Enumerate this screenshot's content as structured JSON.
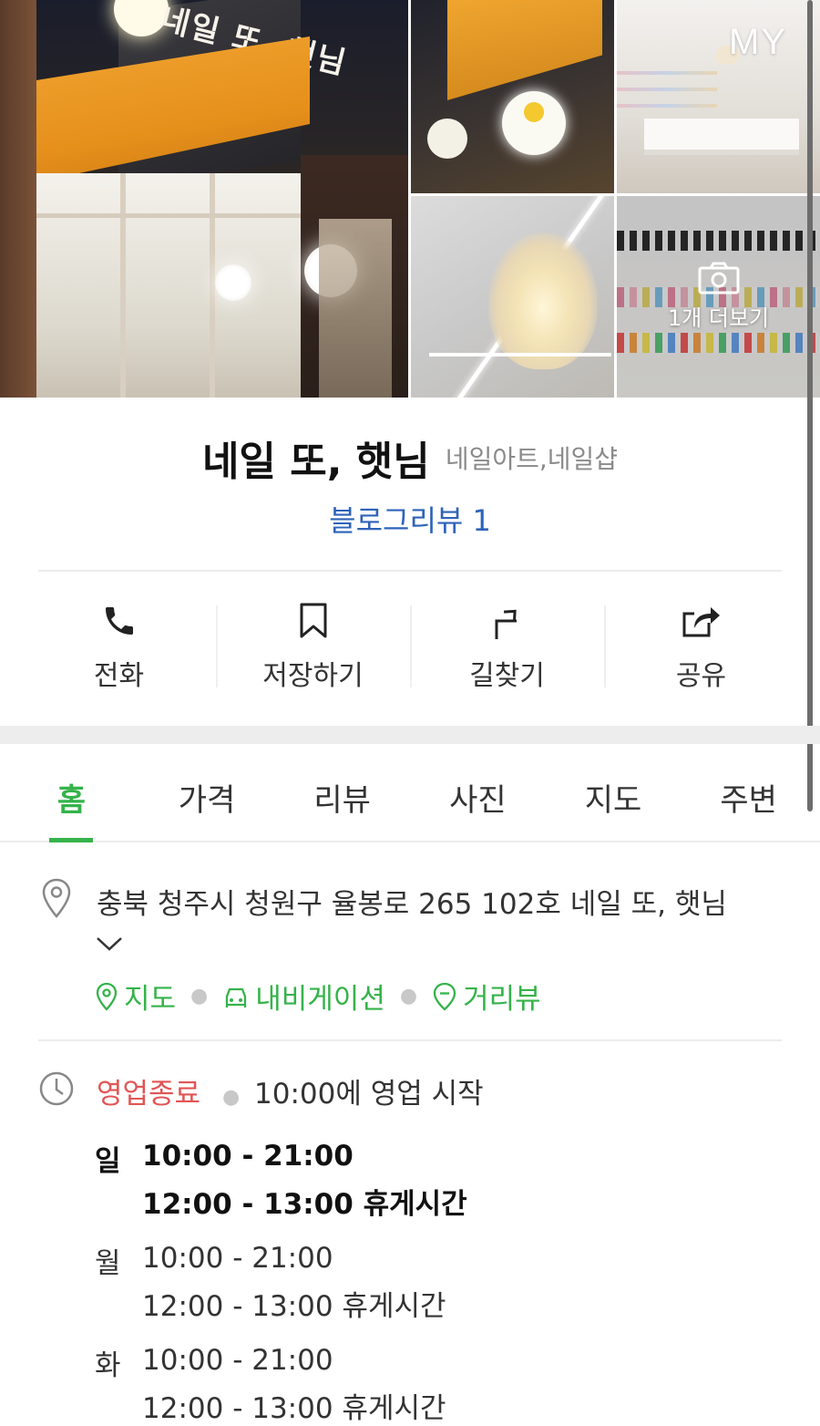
{
  "gallery": {
    "main_sign_text": "네일 또, 햇님",
    "top_right_label": "MY",
    "more_photos_label": "1개 더보기"
  },
  "place": {
    "name": "네일 또, 햇님",
    "category": "네일아트,네일샵",
    "blog_review": "블로그리뷰 1"
  },
  "actions": [
    {
      "label": "전화",
      "icon": "phone-icon"
    },
    {
      "label": "저장하기",
      "icon": "bookmark-icon"
    },
    {
      "label": "길찾기",
      "icon": "directions-icon"
    },
    {
      "label": "공유",
      "icon": "share-icon"
    }
  ],
  "tabs": [
    {
      "label": "홈",
      "active": true
    },
    {
      "label": "가격"
    },
    {
      "label": "리뷰"
    },
    {
      "label": "사진"
    },
    {
      "label": "지도"
    },
    {
      "label": "주변"
    }
  ],
  "address": {
    "text": "충북 청주시 청원구 율봉로 265 102호 네일 또, 햇님",
    "links": [
      "지도",
      "내비게이션",
      "거리뷰"
    ]
  },
  "hours": {
    "status": "영업종료",
    "status_desc": "10:00에 영업 시작",
    "days": [
      {
        "day": "일",
        "hours": "10:00 - 21:00",
        "break": "12:00 - 13:00 휴게시간"
      },
      {
        "day": "월",
        "hours": "10:00 - 21:00",
        "break": "12:00 - 13:00 휴게시간"
      },
      {
        "day": "화",
        "hours": "10:00 - 21:00",
        "break": "12:00 - 13:00 휴게시간"
      }
    ]
  },
  "colors": {
    "accent_green": "#35b34a",
    "link_blue": "#2e63b8",
    "closed_red": "#e25555"
  }
}
